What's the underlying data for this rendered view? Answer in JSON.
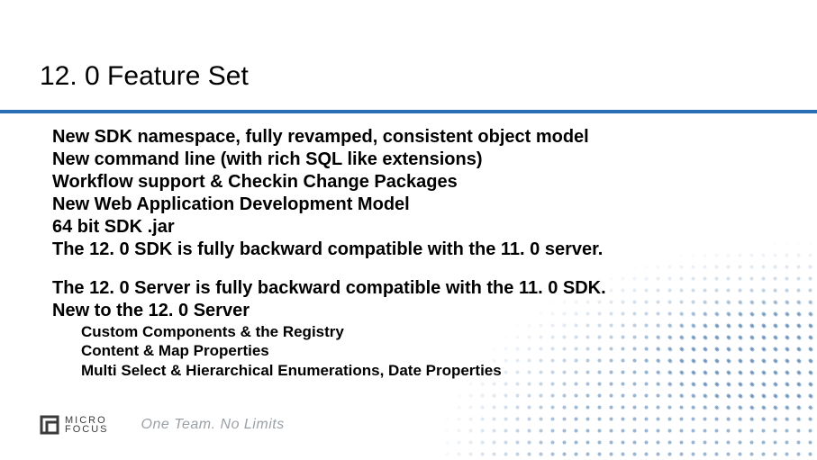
{
  "title": "12. 0 Feature Set",
  "lines": [
    "New SDK namespace, fully revamped, consistent object model",
    "New command line (with rich SQL like extensions)",
    "Workflow support & Checkin Change Packages",
    "New Web Application Development Model",
    "64 bit SDK .jar",
    "The 12. 0 SDK is fully backward compatible with the 11. 0 server."
  ],
  "lines2": [
    "The 12. 0 Server is fully backward compatible with the 11. 0 SDK.",
    "New to the 12. 0 Server"
  ],
  "sublines": [
    "Custom Components & the Registry",
    "Content & Map Properties",
    "Multi Select & Hierarchical Enumerations, Date Properties"
  ],
  "brand": {
    "line1": "MICRO",
    "line2": "FOCUS"
  },
  "tagline": "One Team. No Limits"
}
